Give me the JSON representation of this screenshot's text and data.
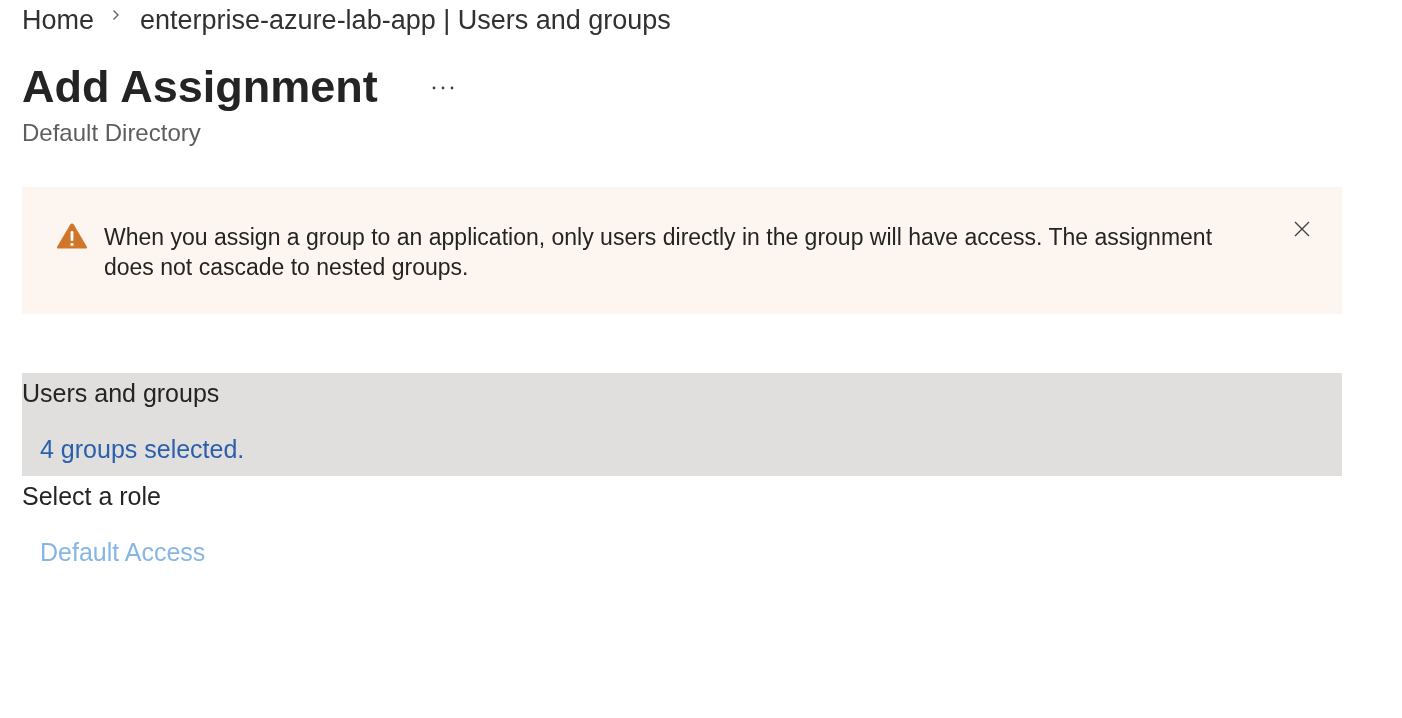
{
  "breadcrumb": [
    {
      "label": "Home"
    },
    {
      "label": "enterprise-azure-lab-app | Users and groups"
    }
  ],
  "header": {
    "title": "Add Assignment",
    "subtitle": "Default Directory"
  },
  "alert": {
    "message": "When you assign a group to an application, only users directly in the group will have access. The assignment does not cascade to nested groups."
  },
  "sections": [
    {
      "label": "Users and groups",
      "selected": true,
      "link": {
        "text": "4 groups selected.",
        "disabled": false
      }
    },
    {
      "label": "Select a role",
      "selected": false,
      "link": {
        "text": "Default Access",
        "disabled": true
      }
    }
  ]
}
